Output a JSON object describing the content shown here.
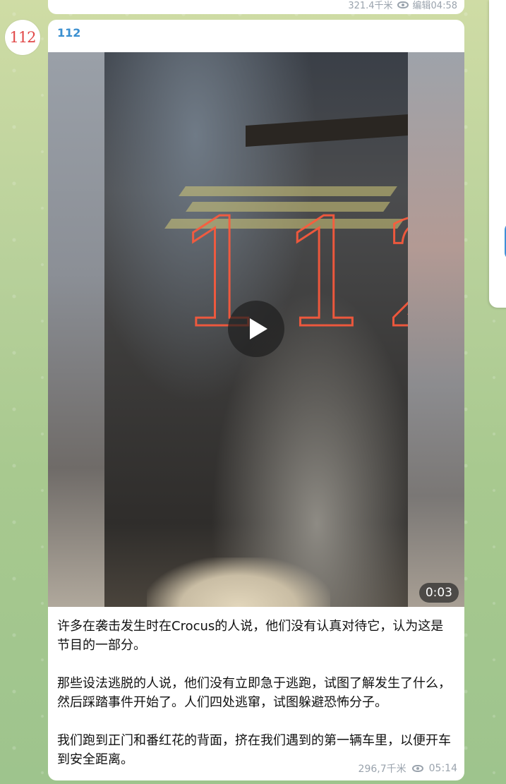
{
  "previous_message": {
    "views": "321.4千米",
    "edited_time": "编辑04:58"
  },
  "avatar": {
    "text": "112"
  },
  "message": {
    "sender": "112",
    "video": {
      "duration": "0:03",
      "overlay_text": "112"
    },
    "paragraphs": [
      "许多在袭击发生时在Crocus的人说，他们没有认真对待它，认为这是节目的一部分。",
      "那些设法逃脱的人说，他们没有立即急于逃跑，试图了解发生了什么，然后踩踏事件开始了。人们四处逃窜，试图躲避恐怖分子。",
      "我们跑到正门和番红花的背面，挤在我们遇到的第一辆车里，以便开车到安全距离。"
    ],
    "views": "296,7千米",
    "time": "05:14"
  },
  "colors": {
    "accent": "#3a8fd0",
    "avatar_text": "#e14848",
    "graffiti": "#ff5a3c"
  }
}
